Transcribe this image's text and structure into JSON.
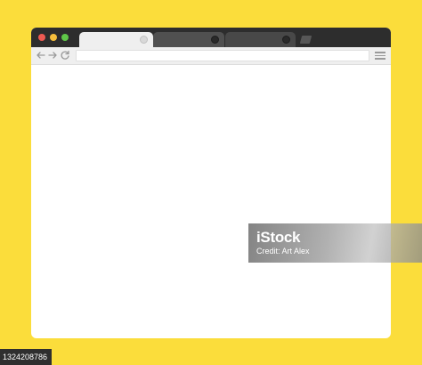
{
  "browser": {
    "traffic_lights": {
      "close_color": "#ee5a52",
      "minimize_color": "#f5be3c",
      "maximize_color": "#5fc748"
    },
    "tabs": [
      {
        "state": "active",
        "close_icon": "tab-close-icon"
      },
      {
        "state": "inactive",
        "close_icon": "tab-close-icon"
      },
      {
        "state": "inactive",
        "close_icon": "tab-close-icon"
      }
    ],
    "new_tab_icon": "new-tab-icon",
    "toolbar": {
      "back_icon": "arrow-left-icon",
      "forward_icon": "arrow-right-icon",
      "reload_icon": "reload-icon",
      "address_value": "",
      "menu_icon": "hamburger-menu-icon"
    }
  },
  "watermark": {
    "brand": "iStock",
    "credit": "Credit: Art Alex"
  },
  "stock_id": "1324208786",
  "colors": {
    "background": "#fbdd3b",
    "titlebar": "#2d2d2d",
    "toolbar": "#efefef"
  }
}
